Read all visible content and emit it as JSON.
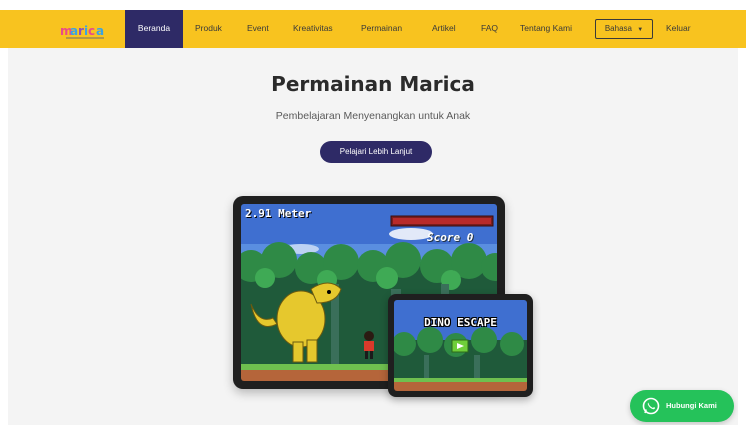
{
  "nav": {
    "logo_text": "marica",
    "items": [
      {
        "label": "Beranda",
        "active": true
      },
      {
        "label": "Produk"
      },
      {
        "label": "Event"
      },
      {
        "label": "Kreativitas"
      },
      {
        "label": "Permainan"
      },
      {
        "label": "Artikel"
      },
      {
        "label": "FAQ"
      },
      {
        "label": "Tentang Kami"
      }
    ],
    "language_button": "Bahasa",
    "logout": "Keluar"
  },
  "hero": {
    "title": "Permainan Marica",
    "subtitle": "Pembelajaran Menyenangkan untuk Anak",
    "cta_label": "Pelajari Lebih Lanjut"
  },
  "game_preview": {
    "distance": "2.91 Meter",
    "score": "Score 0",
    "title": "DINO ESCAPE"
  },
  "whatsapp": {
    "label": "Hubungi Kami"
  },
  "colors": {
    "nav_bg": "#f8c31f",
    "brand_dark": "#2e2a66",
    "whatsapp_green": "#25c25a"
  }
}
